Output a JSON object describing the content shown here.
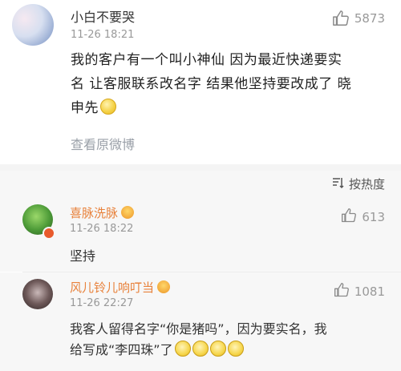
{
  "post": {
    "username": "小白不要哭",
    "timestamp": "11-26 18:21",
    "likes": "5873",
    "text_line1": "我的客户有一个叫小神仙 因为最近快递要实",
    "text_line2": "名 让客服联系改名字 结果他坚持要改成了 晓",
    "text_line3": "申先",
    "view_original": "查看原微博"
  },
  "sort": {
    "label": "按热度"
  },
  "replies": [
    {
      "username": "喜脉洗脉",
      "timestamp": "11-26 18:22",
      "likes": "613",
      "text": "坚持"
    },
    {
      "username": "风儿铃儿响叮当",
      "timestamp": "11-26 22:27",
      "likes": "1081",
      "text_line1": "我客人留得名字“你是猪吗”，因为要实名，我",
      "text_line2": "给写成“李四珠”了"
    }
  ],
  "icons": {
    "like": "thumbs-up-icon",
    "sort": "sort-icon",
    "crown": "vip-crown-icon",
    "emoji_grin": "grin-emoji-icon",
    "emoji_cry": "crying-laugh-emoji-icon"
  },
  "colors": {
    "accent_name": "#e8823c",
    "muted": "#999999",
    "link_muted": "#9aa0a8"
  }
}
